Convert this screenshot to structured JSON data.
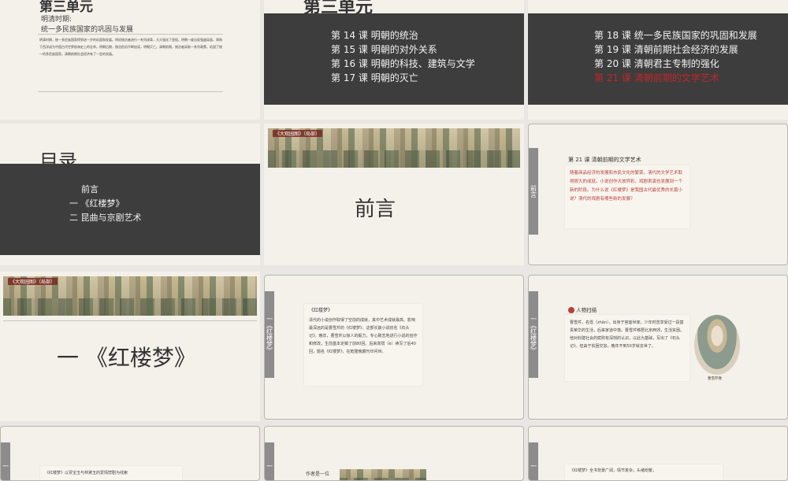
{
  "slides": {
    "s1": {
      "unit_title": "第三单元",
      "period": "明清时期:",
      "subtitle": "统一多民族国家的巩固与发展",
      "body": "明清时期，统一多民族国家得到进一步的巩固和发展。明初统治者进行一系列改革，大大强化了皇权。明朝一度出现强盛局面，郑和下西洋成为中国古代世界航海史上的壮举。明朝后期，统治危机不断加深，明朝灭亡。清朝前期，统治者采取一系列政策，巩固了统一的多民族国家。清朝前期社会经济有了一定的发展。"
    },
    "s2": {
      "header": "第三单元",
      "lessons": [
        "第 14 课  明朝的统治",
        "第 15 课  明朝的对外关系",
        "第 16 课  明朝的科技、建筑与文学",
        "第 17 课  明朝的灭亡"
      ]
    },
    "s3": {
      "lessons": [
        "第 18 课  统一多民族国家的巩固和发展",
        "第 19 课  清朝前期社会经济的发展",
        "第 20 课  清朝君主专制的强化"
      ],
      "highlight": "第 21 课  清朝前期的文学艺术"
    },
    "s4": {
      "title": "目录",
      "items": [
        "前言",
        "一 《红楼梦》",
        "二 昆曲与京剧艺术"
      ]
    },
    "s5": {
      "tag": "《大观园图》（局部）",
      "title": "前言"
    },
    "s6": {
      "tab": "前言",
      "lesson_title": "第 21 课  清朝前期的文学艺术",
      "body": "随着商品经济的发展和市民文化的繁荣，清代的文学艺术取得很大的成就。小说创作大放异彩，戏剧表演也发展到一个新的阶段。为什么说《红楼梦》是我国古代最优秀的长篇小说？清代的戏剧有哪些新的发展？"
    },
    "s7": {
      "tag": "《大观园图》（局部）",
      "title": "一 《红楼梦》"
    },
    "s8": {
      "tab": "一《红楼梦》",
      "heading": "《红楼梦》",
      "body": "清代的小说创作取得了空前的成就，其中艺术成就最高、影响最深远的是曹雪芹的《红楼梦》。这部长篇小说初名《石头记》。晚年，曹雪芹以惊人的毅力，专心致志地进行小说的创作和修改，生前基本定稿了前80回。后来高鹗（è）续写了后40回，题名《红楼梦》，在乾隆晚期刊印问世。"
    },
    "s9": {
      "tab": "一《红楼梦》",
      "heading": "人物扫描",
      "body": "曹雪芹，名霑（zhān），出身于官宦世家。少年时曾享受过一段富贵荣华的生活，后来家道中落。曹雪芹移居北京西郊，生活贫困。他对封建社会的腐败有深刻的认识，以此为基础，写出了《石头记》。但由于贫困交加，晚年不到50岁就去世了。",
      "caption": "曹雪芹像"
    },
    "s10": {
      "tab": "一",
      "text": "《红楼梦》以贾宝玉与林黛玉的爱情悲剧为线索"
    },
    "s11": {
      "tab": "一",
      "text": "作者是一位"
    },
    "s12": {
      "tab": "一",
      "text": "《红楼梦》全书背景广阔，情节复杂，头绪纷繁，"
    }
  },
  "colors": {
    "slide_bg": "#f4f0ea",
    "dark_band": "#3d3d3d",
    "highlight_red": "#c0262c",
    "side_tab": "#8c8c8c"
  }
}
